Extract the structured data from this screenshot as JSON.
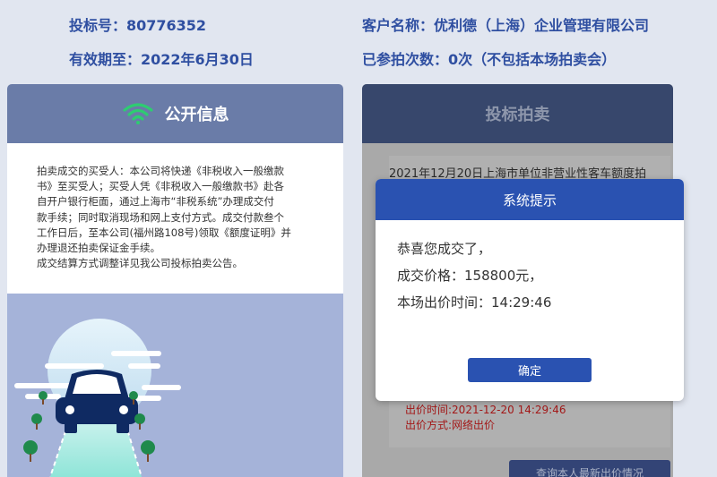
{
  "header": {
    "bid_no": "投标号：80776352",
    "valid_until": "有效期至：2022年6月30日",
    "customer_name": "客户名称：优利德（上海）企业管理有限公司",
    "participated": "已参拍次数：0次（不包括本场拍卖会）"
  },
  "left_panel": {
    "title": "公开信息",
    "icon": "wifi-icon",
    "lines": [
      "拍卖成交的买受人：本公司将快递《非税收入一般缴款",
      "书》至买受人；买受人凭《非税收入一般缴款书》赴各",
      "自开户银行柜面，通过上海市“非税系统”办理成交付",
      "款手续；同时取消现场和网上支付方式。成交付款叁个",
      "工作日后，至本公司(福州路108号)领取《额度证明》并",
      "办理退还拍卖保证金手续。",
      "成交结算方式调整详见我公司投标拍卖公告。"
    ]
  },
  "right_panel": {
    "title": "投标拍卖",
    "description": "2021年12月20日上海市单位非营业性客车额度拍",
    "bid_time": "出价时间:2021-12-20 14:29:46",
    "bid_method": "出价方式:网络出价",
    "query_button": "查询本人最新出价情况"
  },
  "modal": {
    "title": "系统提示",
    "line1": "恭喜您成交了，",
    "line2": "成交价格：158800元，",
    "line3": "本场出价时间：14:29:46",
    "confirm": "确定"
  },
  "colors": {
    "accent": "#2a52b1",
    "header_text": "#2f4fa1",
    "wifi": "#2ecc71",
    "alert_red": "#a31818"
  }
}
